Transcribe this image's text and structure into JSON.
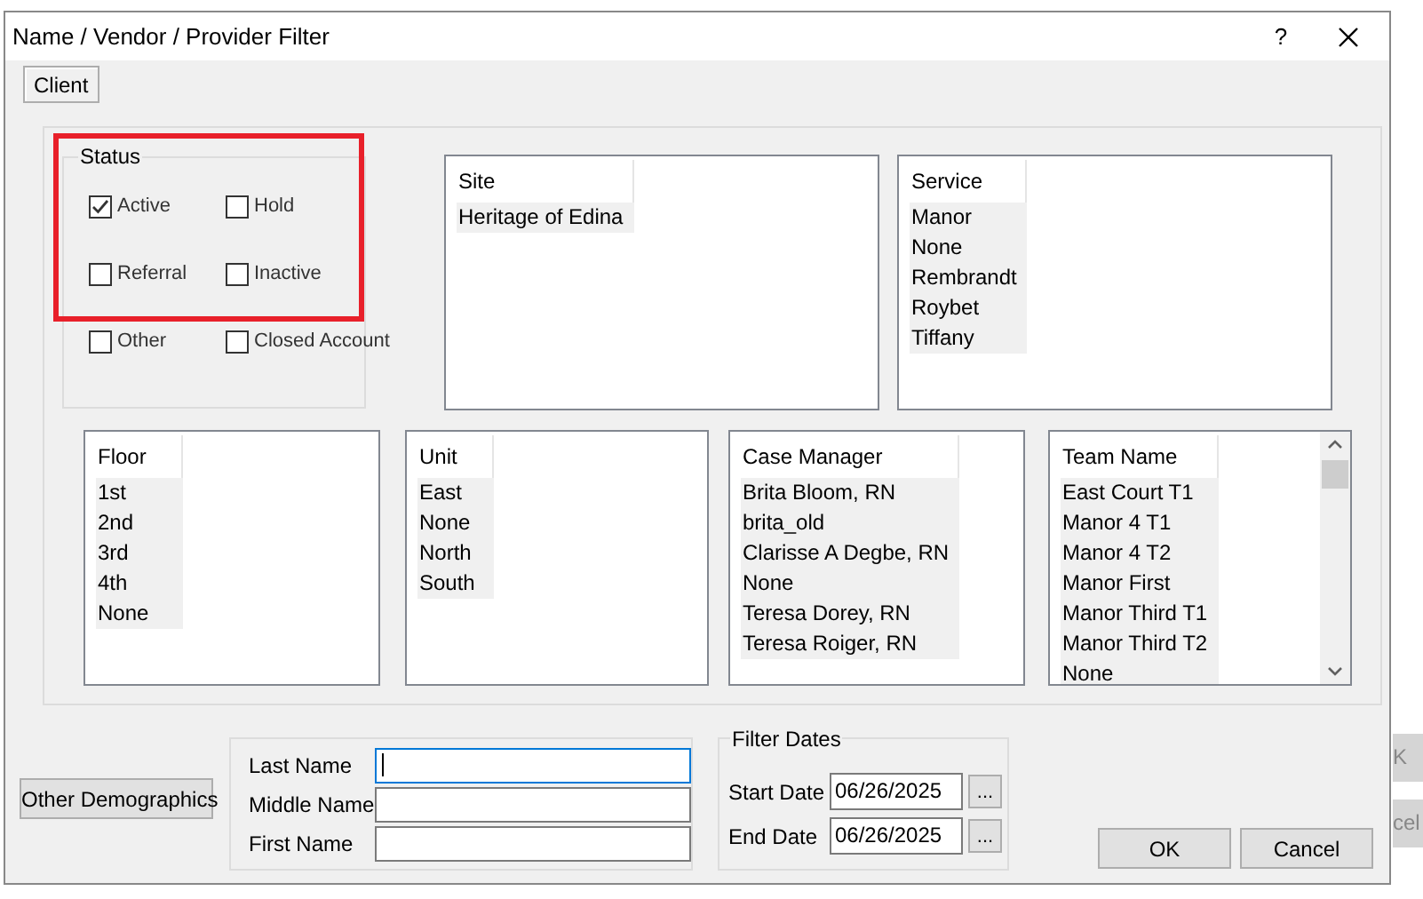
{
  "window": {
    "title": "Name / Vendor / Provider Filter",
    "help": "?"
  },
  "tabs": [
    {
      "label": "Client",
      "selected": true
    }
  ],
  "status": {
    "legend": "Status",
    "options": [
      {
        "label": "Active",
        "checked": true
      },
      {
        "label": "Hold",
        "checked": false
      },
      {
        "label": "Referral",
        "checked": false
      },
      {
        "label": "Inactive",
        "checked": false
      },
      {
        "label": "Other",
        "checked": false
      },
      {
        "label": "Closed Account",
        "checked": false
      }
    ]
  },
  "top_lists": [
    {
      "header": "Site",
      "items": [
        "Heritage of Edina"
      ]
    },
    {
      "header": "Service",
      "items": [
        "Manor",
        "None",
        "Rembrandt",
        "Roybet",
        "Tiffany"
      ]
    }
  ],
  "bottom_lists": [
    {
      "header": "Floor",
      "items": [
        "1st",
        "2nd",
        "3rd",
        "4th",
        "None"
      ],
      "scrollable": false
    },
    {
      "header": "Unit",
      "items": [
        "East",
        "None",
        "North",
        "South"
      ],
      "scrollable": false
    },
    {
      "header": "Case Manager",
      "items": [
        "Brita Bloom, RN",
        "brita_old",
        "Clarisse A Degbe, RN",
        "None",
        "Teresa Dorey, RN",
        "Teresa Roiger, RN"
      ],
      "scrollable": false
    },
    {
      "header": "Team Name",
      "items": [
        "East Court T1",
        "Manor 4 T1",
        "Manor 4 T2",
        "Manor First",
        "Manor Third T1",
        "Manor Third T2",
        "None"
      ],
      "scrollable": true
    }
  ],
  "other_demographics": "Other Demographics",
  "name_fields": [
    {
      "label": "Last Name",
      "focused": true
    },
    {
      "label": "Middle Name",
      "focused": false
    },
    {
      "label": "First Name",
      "focused": false
    }
  ],
  "filter_dates": {
    "legend": "Filter Dates",
    "fields": [
      {
        "label": "Start Date",
        "value": "06/26/2025",
        "button": "..."
      },
      {
        "label": "End Date",
        "value": "06/26/2025",
        "button": "..."
      }
    ]
  },
  "buttons": [
    {
      "label": "OK"
    },
    {
      "label": "Cancel"
    }
  ],
  "background_buttons": [
    "K",
    "cel"
  ]
}
